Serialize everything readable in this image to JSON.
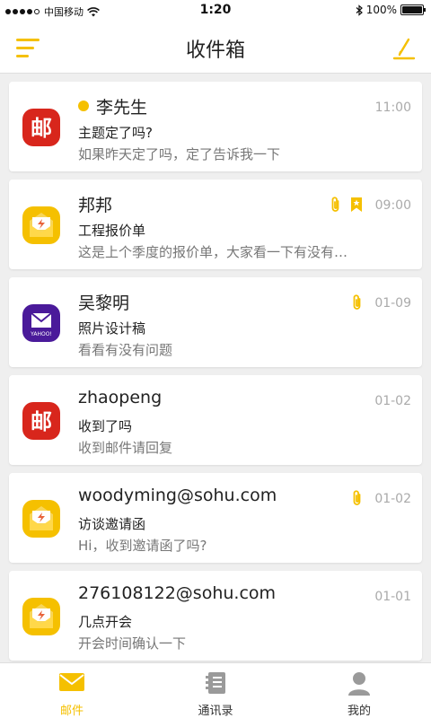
{
  "status": {
    "carrier": "中国移动",
    "time": "1:20",
    "battery": "100%",
    "battery_level": 1.0
  },
  "header": {
    "title": "收件箱",
    "menu_icon": "hamburger-menu-icon",
    "compose_icon": "compose-pen-icon"
  },
  "colors": {
    "accent": "#f5c000",
    "netease_red": "#d8261c",
    "yahoo_purple": "#4a1a9a"
  },
  "mails": [
    {
      "sender": "李先生",
      "subject": "主题定了吗?",
      "preview": "如果昨天定了吗，定了告诉我一下",
      "time": "11:00",
      "avatar": "netease-mail-icon",
      "unread": true,
      "attachment": false,
      "flagged": false
    },
    {
      "sender": "邦邦",
      "subject": "工程报价单",
      "preview": "这是上个季度的报价单，大家看一下有没有…",
      "time": "09:00",
      "avatar": "yellow-envelope-icon",
      "unread": false,
      "attachment": true,
      "flagged": true
    },
    {
      "sender": "吴黎明",
      "subject": "照片设计稿",
      "preview": "看看有没有问题",
      "time": "01-09",
      "avatar": "yahoo-mail-icon",
      "unread": false,
      "attachment": true,
      "flagged": false
    },
    {
      "sender": "zhaopeng",
      "subject": "收到了吗",
      "preview": "收到邮件请回复",
      "time": "01-02",
      "avatar": "netease-mail-icon",
      "unread": false,
      "attachment": false,
      "flagged": false
    },
    {
      "sender": "woodyming@sohu.com",
      "subject": "访谈邀请函",
      "preview": "Hi，收到邀请函了吗?",
      "time": "01-02",
      "avatar": "yellow-envelope-icon",
      "unread": false,
      "attachment": true,
      "flagged": false
    },
    {
      "sender": "276108122@sohu.com",
      "subject": "几点开会",
      "preview": "开会时间确认一下",
      "time": "01-01",
      "avatar": "yellow-envelope-icon",
      "unread": false,
      "attachment": false,
      "flagged": false
    }
  ],
  "avatar_text": {
    "netease": "邮",
    "yahoo": "YAHOO!"
  },
  "tabs": [
    {
      "label": "邮件",
      "icon": "mail-icon",
      "active": true
    },
    {
      "label": "通讯录",
      "icon": "contacts-book-icon",
      "active": false
    },
    {
      "label": "我的",
      "icon": "profile-icon",
      "active": false
    }
  ]
}
